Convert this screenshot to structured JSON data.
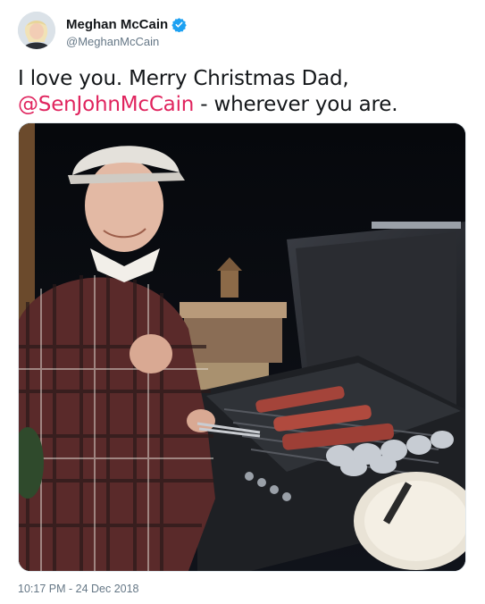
{
  "author": {
    "display_name": "Meghan McCain",
    "handle": "@MeghanMcCain",
    "verified": true,
    "avatar_icon": "profile-photo"
  },
  "tweet": {
    "text_part1": "I love you. Merry Christmas Dad,",
    "mention": "@SenJohnMcCain",
    "text_part2": " - wherever you are.",
    "timestamp": "10:17 PM - 24 Dec 2018"
  },
  "media": {
    "icon": "photo"
  },
  "colors": {
    "mention": "#e0245e",
    "verified": "#1da1f2",
    "muted": "#657786",
    "text": "#14171a"
  }
}
